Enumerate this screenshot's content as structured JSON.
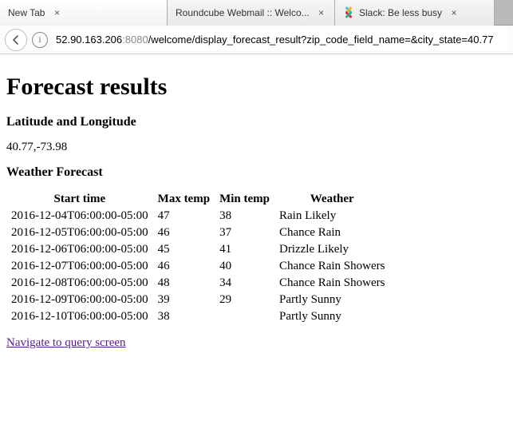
{
  "browser": {
    "tabs": [
      {
        "label": "New Tab"
      },
      {
        "label": "Roundcube Webmail :: Welco..."
      },
      {
        "label": "Slack: Be less busy"
      }
    ],
    "url": {
      "host": "52.90.163.206",
      "port": ":8080",
      "path": "/welcome/display_forecast_result?zip_code_field_name=&city_state=40.77"
    }
  },
  "page": {
    "title": "Forecast results",
    "section_latlon": "Latitude and Longitude",
    "coords": "40.77,-73.98",
    "section_forecast": "Weather Forecast",
    "nav_link": "Navigate to query screen",
    "headers": {
      "start": "Start time",
      "max": "Max temp",
      "min": "Min temp",
      "weather": "Weather"
    },
    "rows": [
      {
        "start": "2016-12-04T06:00:00-05:00",
        "max": "47",
        "min": "38",
        "weather": "Rain Likely"
      },
      {
        "start": "2016-12-05T06:00:00-05:00",
        "max": "46",
        "min": "37",
        "weather": "Chance Rain"
      },
      {
        "start": "2016-12-06T06:00:00-05:00",
        "max": "45",
        "min": "41",
        "weather": "Drizzle Likely"
      },
      {
        "start": "2016-12-07T06:00:00-05:00",
        "max": "46",
        "min": "40",
        "weather": "Chance Rain Showers"
      },
      {
        "start": "2016-12-08T06:00:00-05:00",
        "max": "48",
        "min": "34",
        "weather": "Chance Rain Showers"
      },
      {
        "start": "2016-12-09T06:00:00-05:00",
        "max": "39",
        "min": "29",
        "weather": "Partly Sunny"
      },
      {
        "start": "2016-12-10T06:00:00-05:00",
        "max": "38",
        "min": "",
        "weather": "Partly Sunny"
      }
    ]
  }
}
